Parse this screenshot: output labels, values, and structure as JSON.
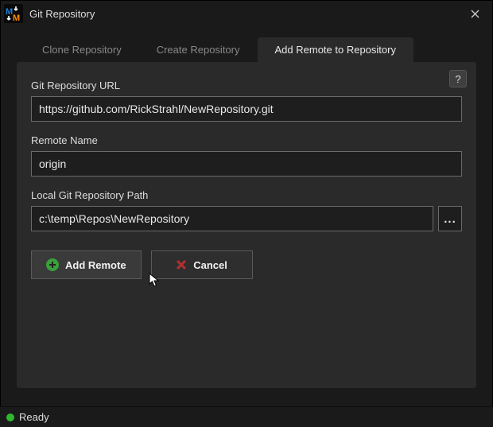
{
  "window": {
    "title": "Git Repository"
  },
  "tabs": {
    "clone": "Clone Repository",
    "create": "Create Repository",
    "addRemote": "Add Remote to Repository"
  },
  "form": {
    "urlLabel": "Git Repository URL",
    "urlValue": "https://github.com/RickStrahl/NewRepository.git",
    "remoteNameLabel": "Remote Name",
    "remoteNameValue": "origin",
    "localPathLabel": "Local Git Repository Path",
    "localPathValue": "c:\\temp\\Repos\\NewRepository",
    "browseLabel": "..."
  },
  "buttons": {
    "addRemote": "Add Remote",
    "cancel": "Cancel"
  },
  "help": "?",
  "status": {
    "text": "Ready"
  }
}
